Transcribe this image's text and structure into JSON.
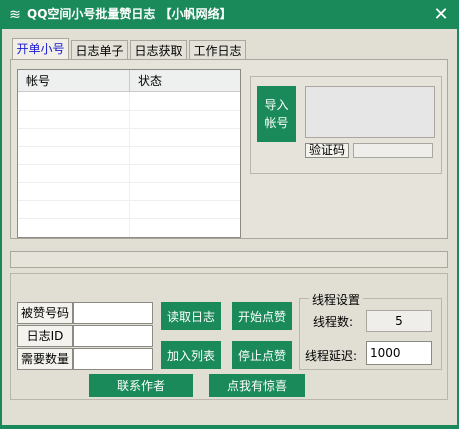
{
  "window": {
    "title": "QQ空间小号批量赞日志 【小帆网络】",
    "close": "✕"
  },
  "tabs": [
    {
      "label": "开单小号"
    },
    {
      "label": "日志单子"
    },
    {
      "label": "日志获取"
    },
    {
      "label": "工作日志"
    }
  ],
  "account_table": {
    "columns": [
      "帐号",
      "状态"
    ]
  },
  "import": {
    "button": "导入\n帐号",
    "captcha_label": "验证码"
  },
  "form": {
    "liked_qq_label": "被赞号码",
    "log_id_label": "日志ID",
    "quantity_label": "需要数量",
    "liked_qq_value": "",
    "log_id_value": "",
    "quantity_value": ""
  },
  "actions": {
    "read_log": "读取日志",
    "start_like": "开始点赞",
    "add_list": "加入列表",
    "stop_like": "停止点赞",
    "contact_author": "联系作者",
    "surprise": "点我有惊喜"
  },
  "thread": {
    "group_title": "线程设置",
    "count_label": "线程数:",
    "count_value": "5",
    "delay_label": "线程延迟:",
    "delay_value": "1000"
  },
  "colors": {
    "accent": "#1b8a5a",
    "panel": "#e1ded4",
    "active_tab_text": "#1a1ad0"
  }
}
